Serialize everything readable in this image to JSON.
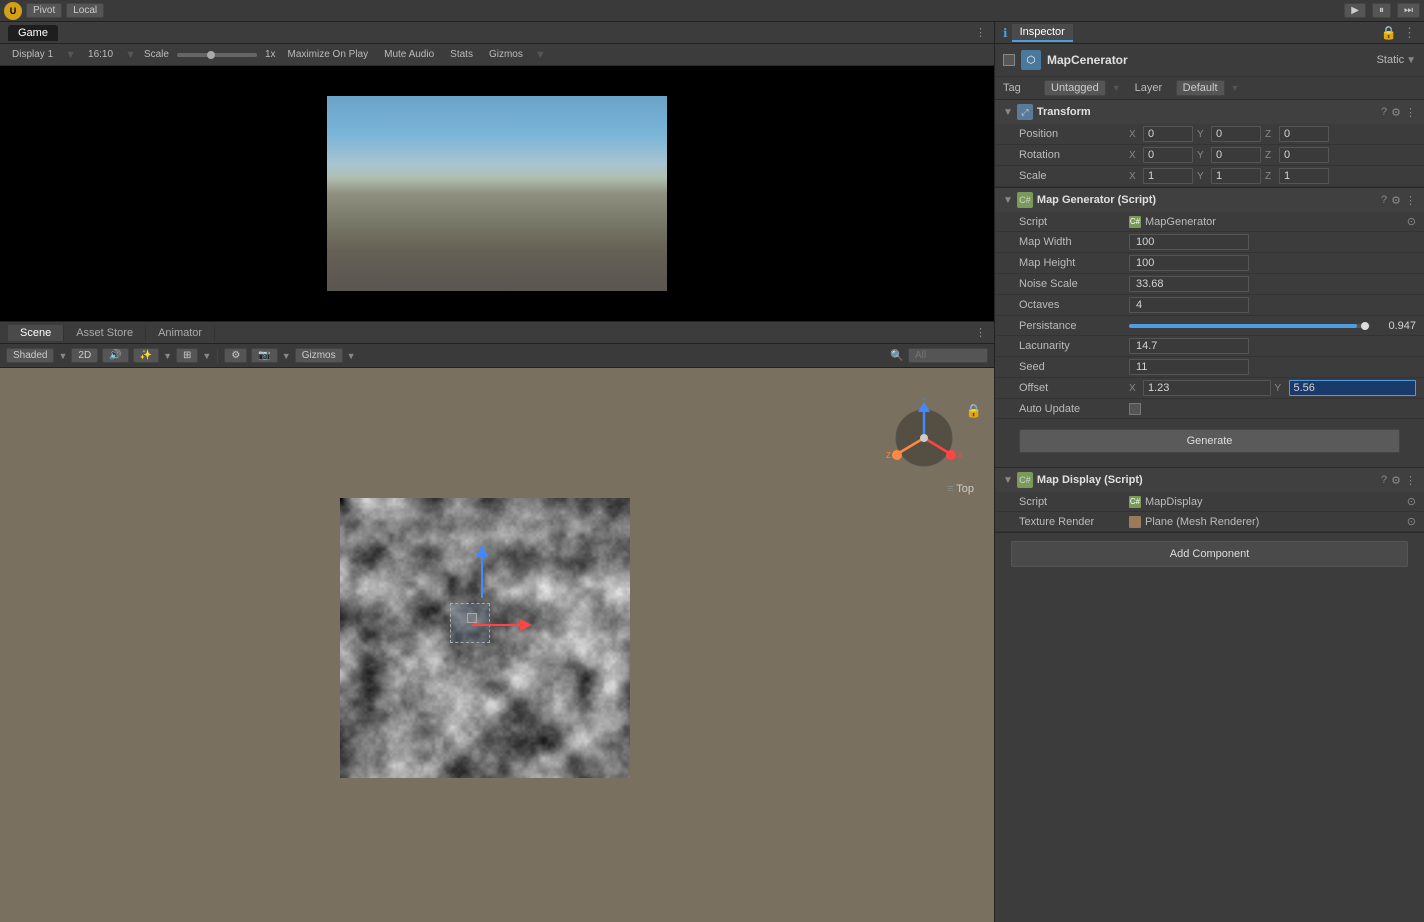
{
  "toolbar": {
    "logo": "U",
    "pivot_label": "Pivot",
    "local_label": "Local"
  },
  "game_panel": {
    "tab_label": "Game",
    "display_label": "Display 1",
    "ratio_label": "16:10",
    "scale_label": "Scale",
    "scale_value": "1x",
    "maximize_on_play": "Maximize On Play",
    "mute_audio": "Mute Audio",
    "stats": "Stats",
    "gizmos": "Gizmos"
  },
  "scene_panel": {
    "tabs": [
      "Scene",
      "Asset Store",
      "Animator"
    ],
    "shading_mode": "Shaded",
    "two_d": "2D",
    "gizmos_label": "Gizmos",
    "all_label": "All",
    "search_placeholder": "All"
  },
  "inspector": {
    "title": "Inspector",
    "object_name": "MapCenerator",
    "static_label": "Static",
    "tag_label": "Tag",
    "tag_value": "Untagged",
    "layer_label": "Layer",
    "layer_value": "Default",
    "transform": {
      "title": "Transform",
      "position_label": "Position",
      "position": {
        "x": "0",
        "y": "0",
        "z": "0"
      },
      "rotation_label": "Rotation",
      "rotation": {
        "x": "0",
        "y": "0",
        "z": "0"
      },
      "scale_label": "Scale",
      "scale": {
        "x": "1",
        "y": "1",
        "z": "1"
      }
    },
    "map_generator": {
      "title": "Map Generator (Script)",
      "script_label": "Script",
      "script_name": "MapGenerator",
      "map_width_label": "Map Width",
      "map_width_value": "100",
      "map_height_label": "Map Height",
      "map_height_value": "100",
      "noise_scale_label": "Noise Scale",
      "noise_scale_value": "33.68",
      "octaves_label": "Octaves",
      "octaves_value": "4",
      "persistance_label": "Persistance",
      "persistance_value": "0.947",
      "lacunarity_label": "Lacunarity",
      "lacunarity_value": "14.7",
      "seed_label": "Seed",
      "seed_value": "11",
      "offset_label": "Offset",
      "offset_x": "1.23",
      "offset_y": "5.56",
      "auto_update_label": "Auto Update",
      "generate_btn": "Generate"
    },
    "map_display": {
      "title": "Map Display (Script)",
      "script_label": "Script",
      "script_name": "MapDisplay",
      "texture_render_label": "Texture Render",
      "texture_render_value": "Plane (Mesh Renderer)"
    },
    "add_component_btn": "Add Component"
  },
  "scene_viewport": {
    "top_label": "Top"
  }
}
